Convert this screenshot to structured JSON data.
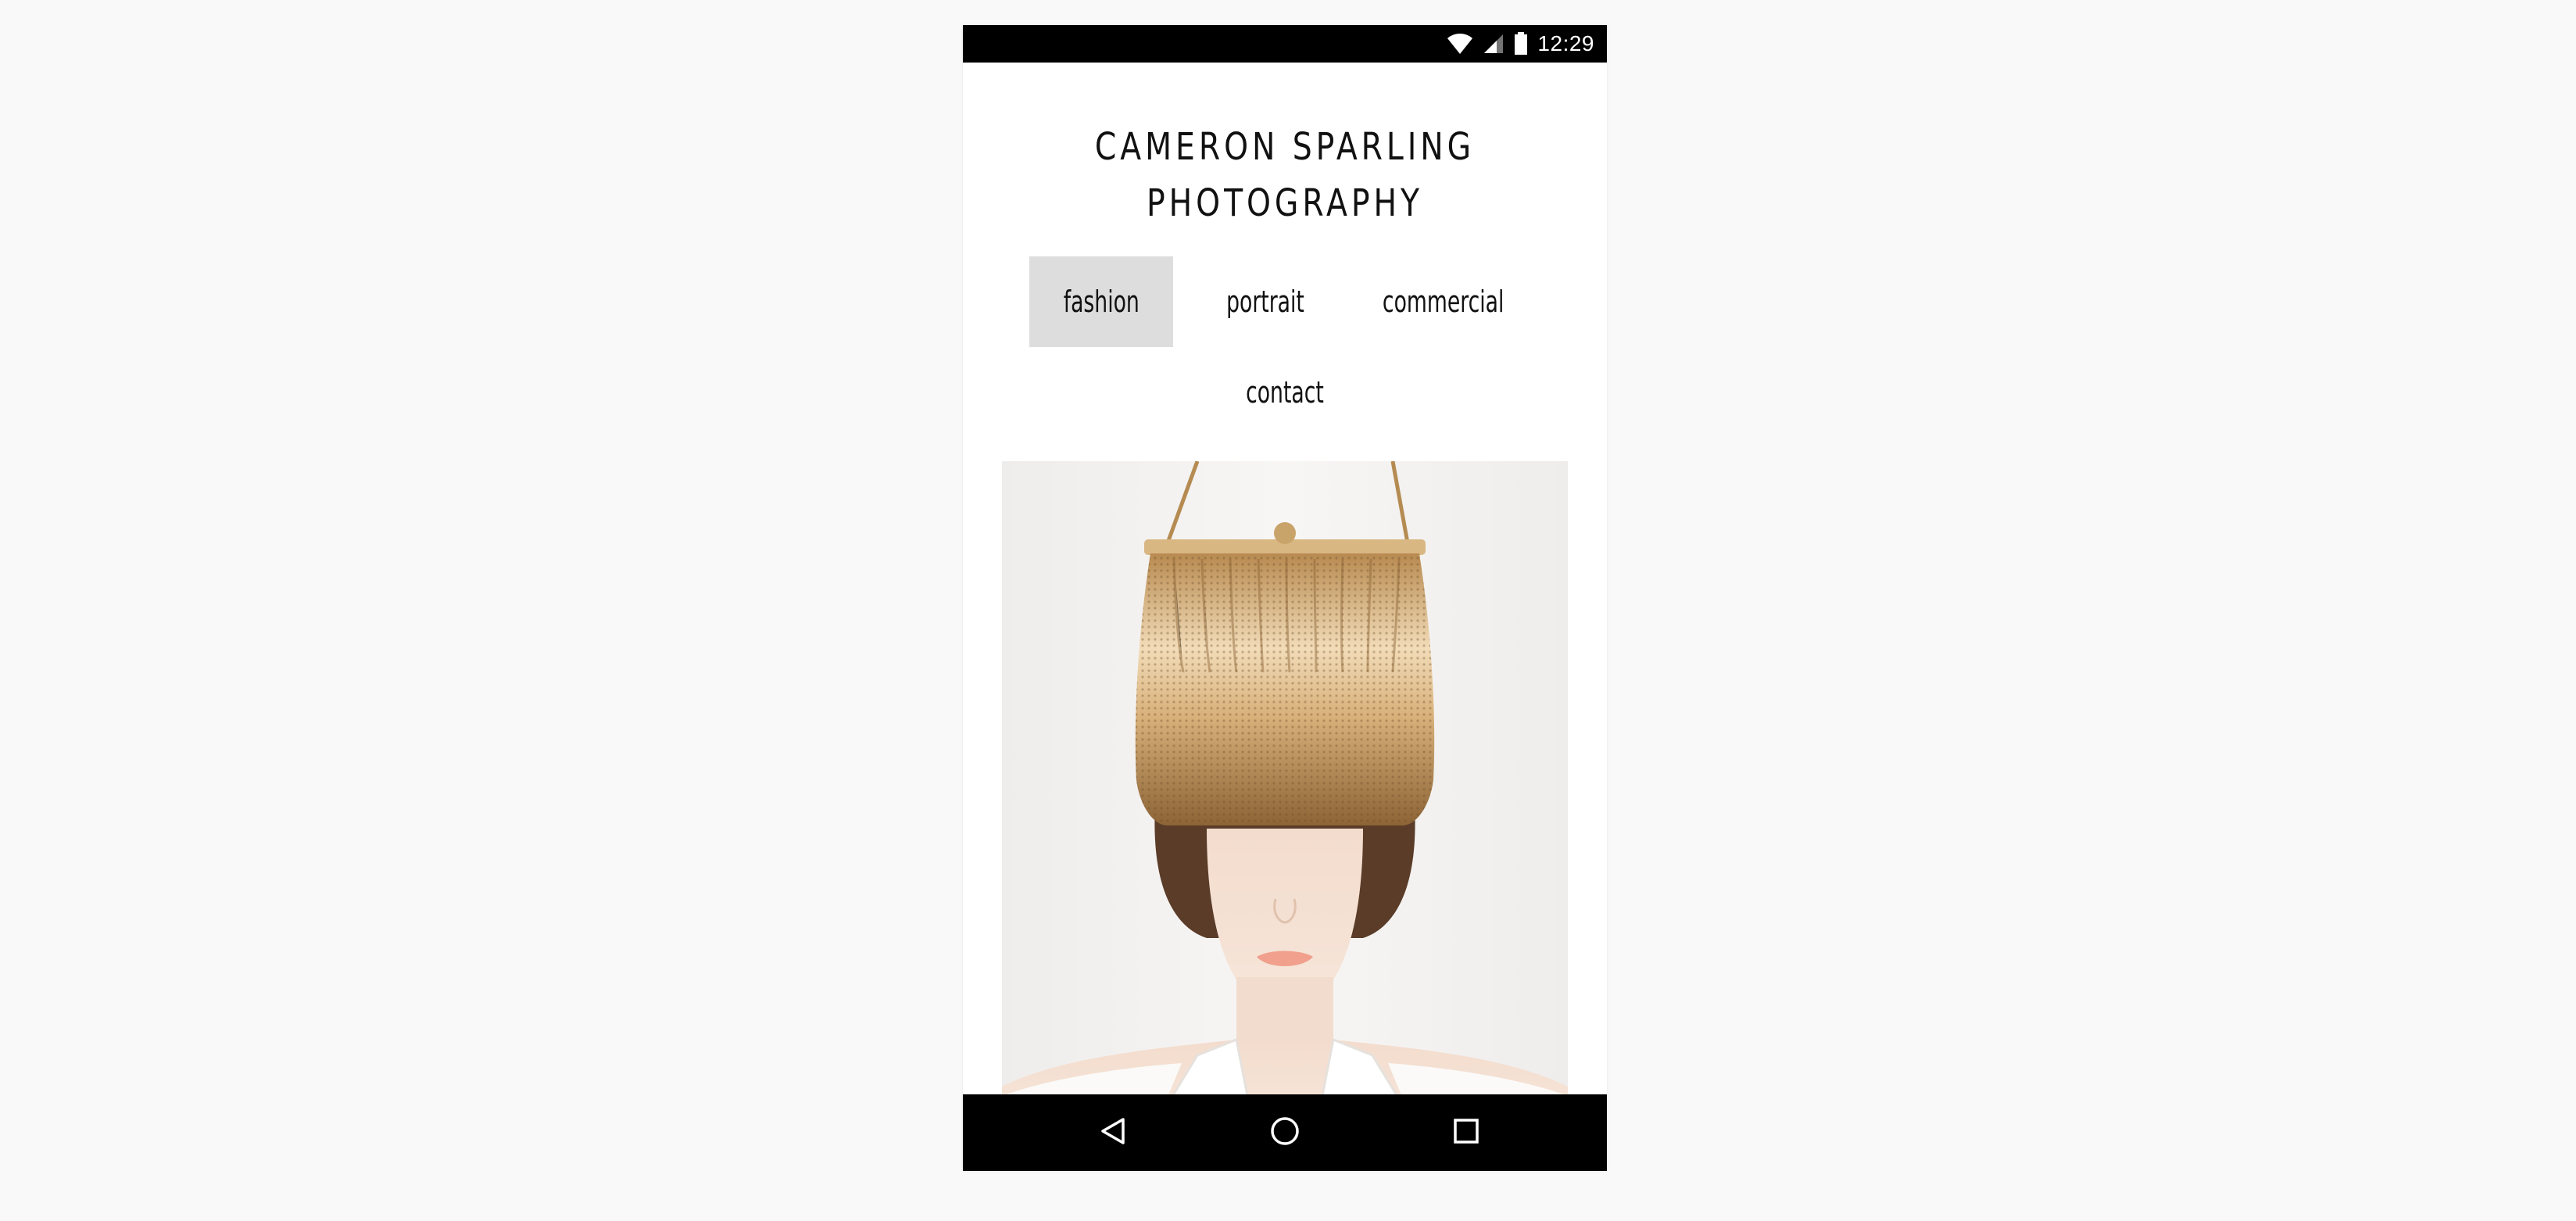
{
  "status_bar": {
    "time": "12:29",
    "icons": [
      "wifi-icon",
      "cell-signal-icon",
      "battery-icon"
    ]
  },
  "site": {
    "title_line1": "CAMERON SPARLING",
    "title_line2": "PHOTOGRAPHY"
  },
  "nav": {
    "items": [
      {
        "label": "fashion",
        "active": true
      },
      {
        "label": "portrait",
        "active": false
      },
      {
        "label": "commercial",
        "active": false
      },
      {
        "label": "contact",
        "active": false
      }
    ],
    "active_bg_color": "#dddddd"
  },
  "photo": {
    "subject": "model wearing gold mesh handbag over eyes",
    "background_color": "#f4f2f1",
    "accent_gold": "#c9a46a"
  },
  "system_nav": {
    "buttons": [
      "back-icon",
      "home-icon",
      "recents-icon"
    ]
  }
}
